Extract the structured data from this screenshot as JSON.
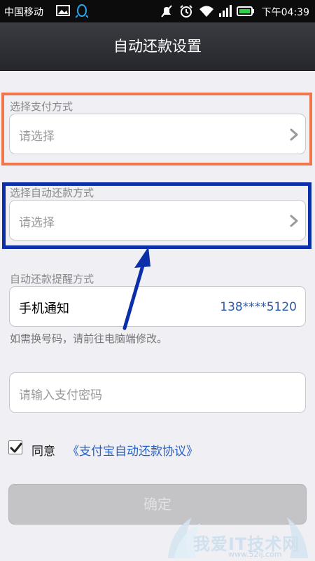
{
  "status_bar": {
    "carrier": "中国移动",
    "time": "下午04:39",
    "icons": [
      "image-icon",
      "qq-icon",
      "mute-icon",
      "alarm-icon",
      "wifi-icon",
      "signal-icon",
      "battery-icon"
    ]
  },
  "header": {
    "title": "自动还款设置"
  },
  "payment_method": {
    "label": "选择支付方式",
    "placeholder": "请选择"
  },
  "repay_method": {
    "label": "选择自动还款方式",
    "placeholder": "请选择"
  },
  "reminder": {
    "label": "自动还款提醒方式",
    "type": "手机通知",
    "phone": "138****5120",
    "hint": "如需换号码，请前往电脑端修改。"
  },
  "password": {
    "placeholder": "请输入支付密码"
  },
  "agreement": {
    "checked": true,
    "prefix": "同意",
    "link": "《支付宝自动还款协议》"
  },
  "confirm": {
    "label": "确定"
  },
  "watermark": {
    "text": "我爱IT技术网",
    "url": "www.52ij.com"
  },
  "colors": {
    "highlight_orange": "#f07848",
    "highlight_blue": "#0b2fa8",
    "link": "#2660c4",
    "title_bar": "#2f3136"
  }
}
